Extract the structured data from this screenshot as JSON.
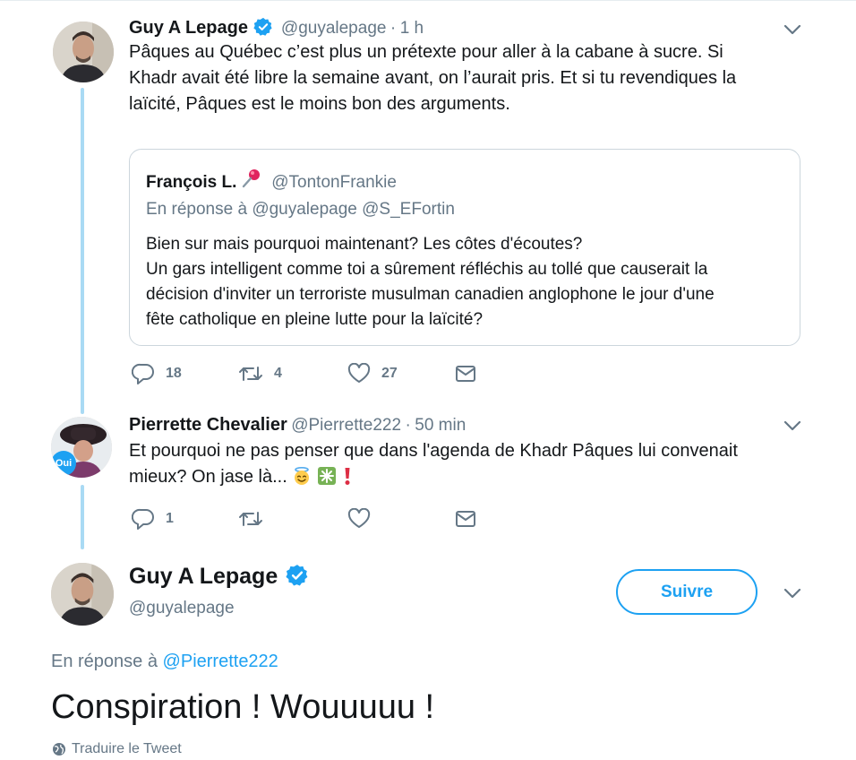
{
  "tweet1": {
    "name": "Guy A Lepage",
    "handle": "@guyalepage",
    "separator": "·",
    "time": "1 h",
    "text_lines": [
      "Pâques au Québec c’est plus un prétexte pour aller à la cabane à sucre. Si",
      "Khadr avait été libre la semaine avant, on l’aurait pris. Et si tu revendiques la",
      "laïcité, Pâques est le moins bon des arguments."
    ],
    "quote": {
      "name": "François L.",
      "handle": "@TontonFrankie",
      "reply_prefix": "En réponse à",
      "reply_to": "@guyalepage @S_EFortin",
      "text_lines": [
        "Bien sur mais pourquoi maintenant? Les côtes d'écoutes?",
        "Un gars intelligent comme toi a sûrement réfléchis au tollé que causerait la",
        "décision d'inviter un terroriste musulman canadien anglophone le jour d'une",
        "fête catholique en pleine lutte pour la laïcité?"
      ]
    },
    "actions": {
      "replies": "18",
      "retweets": "4",
      "likes": "27"
    }
  },
  "tweet2": {
    "name": "Pierrette Chevalier",
    "handle": "@Pierrette222",
    "separator": "·",
    "time": "50 min",
    "avatar_badge": "Oui",
    "text_line1": "Et pourquoi ne pas penser que dans l'agenda de Khadr Pâques lui convenait",
    "text_line2": "mieux? On jase là...",
    "actions": {
      "replies": "1",
      "retweets": "",
      "likes": ""
    }
  },
  "main_tweet": {
    "name": "Guy A Lepage",
    "handle": "@guyalepage",
    "follow_label": "Suivre",
    "reply_prefix": "En réponse à",
    "reply_to": "@Pierrette222",
    "text": "Conspiration ! Wouuuuu !",
    "translate_label": "Traduire le Tweet"
  },
  "colors": {
    "accent": "#1da1f2",
    "muted": "#657786",
    "text": "#14171a",
    "thread_line": "#a9daf4"
  },
  "icons": [
    "verified-badge-icon",
    "chevron-down-icon",
    "reply-icon",
    "retweet-icon",
    "like-icon",
    "message-icon",
    "globe-icon",
    "pushpin-icon",
    "angel-emoji",
    "sparkle-emoji",
    "exclamation-emoji"
  ]
}
